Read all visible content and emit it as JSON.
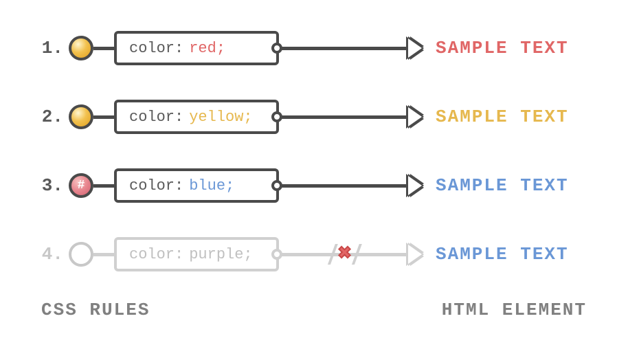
{
  "rows": [
    {
      "num": "1.",
      "selector": "element",
      "property": "color:",
      "value": "red;",
      "valueClass": "red",
      "sample": "SAMPLE TEXT",
      "sampleClass": "red",
      "blocked": false
    },
    {
      "num": "2.",
      "selector": "element",
      "property": "color:",
      "value": "yellow;",
      "valueClass": "yellow",
      "sample": "SAMPLE TEXT",
      "sampleClass": "yellow",
      "blocked": false
    },
    {
      "num": "3.",
      "selector": "id",
      "property": "color:",
      "value": "blue;",
      "valueClass": "blue",
      "sample": "SAMPLE TEXT",
      "sampleClass": "blue",
      "blocked": false
    },
    {
      "num": "4.",
      "selector": "empty",
      "property": "color:",
      "value": "purple;",
      "valueClass": "purple",
      "sample": "SAMPLE TEXT",
      "sampleClass": "blue",
      "blocked": true
    }
  ],
  "footer": {
    "left": "CSS RULES",
    "right": "HTML ELEMENT"
  },
  "hashSymbol": "#"
}
